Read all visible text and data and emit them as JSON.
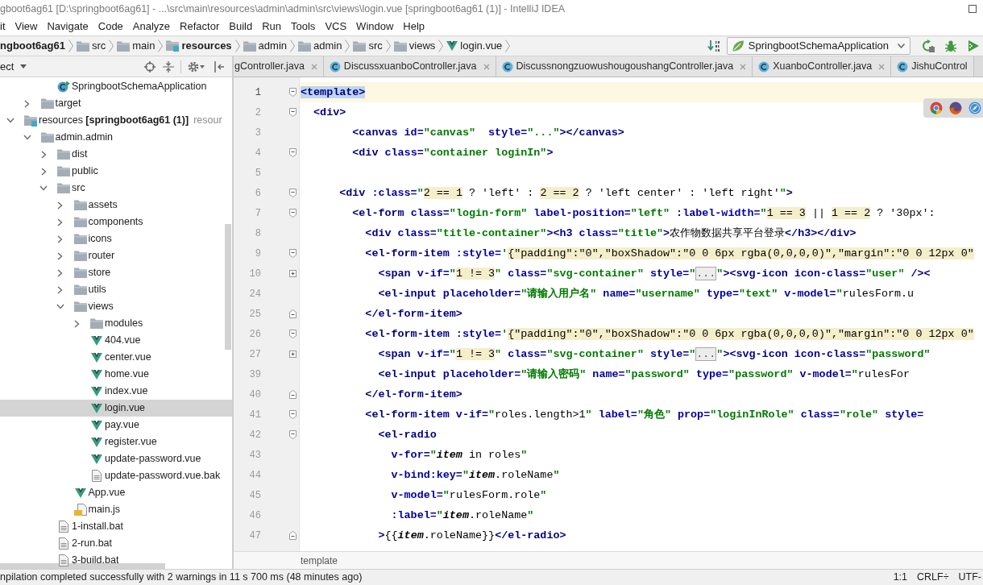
{
  "window": {
    "title": "gboot6ag61 [D:\\springboot6ag61] - ...\\src\\main\\resources\\admin\\admin\\src\\views\\login.vue [springboot6ag61 (1)] - IntelliJ IDEA"
  },
  "menu": [
    "it",
    "View",
    "Navigate",
    "Code",
    "Analyze",
    "Refactor",
    "Build",
    "Run",
    "Tools",
    "VCS",
    "Window",
    "Help"
  ],
  "navigation": {
    "crumbs": [
      {
        "label": "ngboot6ag61",
        "kind": "project"
      },
      {
        "label": "src",
        "kind": "folder"
      },
      {
        "label": "main",
        "kind": "folder"
      },
      {
        "label": "resources",
        "kind": "resources"
      },
      {
        "label": "admin",
        "kind": "folder"
      },
      {
        "label": "admin",
        "kind": "folder"
      },
      {
        "label": "src",
        "kind": "folder"
      },
      {
        "label": "views",
        "kind": "folder"
      },
      {
        "label": "login.vue",
        "kind": "vue"
      }
    ],
    "run_config": "SpringbootSchemaApplication"
  },
  "project_panel": {
    "title": "ect",
    "tree": [
      {
        "children": [
          {
            "children": [
              {
                "label": "SpringbootSchemaApplication",
                "kind": "class",
                "selected": false
              }
            ]
          },
          {
            "label": "target",
            "kind": "folder",
            "expanded": false,
            "selected": false
          }
        ]
      },
      {
        "label": "resources **[springboot6ag61 (1)]**",
        "hint": "resour",
        "kind": "resources",
        "expanded": true,
        "selected": false,
        "children": [
          {
            "label": "admin.admin",
            "kind": "folder",
            "expanded": true,
            "selected": false,
            "children": [
              {
                "label": "dist",
                "kind": "folder",
                "expanded": false,
                "selected": false
              },
              {
                "label": "public",
                "kind": "folder",
                "expanded": false,
                "selected": false
              },
              {
                "label": "src",
                "kind": "folder",
                "expanded": true,
                "selected": false,
                "children": [
                  {
                    "label": "assets",
                    "kind": "folder",
                    "expanded": false,
                    "selected": false
                  },
                  {
                    "label": "components",
                    "kind": "folder",
                    "expanded": false,
                    "selected": false
                  },
                  {
                    "label": "icons",
                    "kind": "folder",
                    "expanded": false,
                    "selected": false
                  },
                  {
                    "label": "router",
                    "kind": "folder",
                    "expanded": false,
                    "selected": false
                  },
                  {
                    "label": "store",
                    "kind": "folder",
                    "expanded": false,
                    "selected": false
                  },
                  {
                    "label": "utils",
                    "kind": "folder",
                    "expanded": false,
                    "selected": false
                  },
                  {
                    "label": "views",
                    "kind": "folder",
                    "expanded": true,
                    "selected": false,
                    "children": [
                      {
                        "label": "modules",
                        "kind": "folder",
                        "expanded": false,
                        "selected": false
                      },
                      {
                        "label": "404.vue",
                        "kind": "vue",
                        "selected": false
                      },
                      {
                        "label": "center.vue",
                        "kind": "vue",
                        "selected": false
                      },
                      {
                        "label": "home.vue",
                        "kind": "vue",
                        "selected": false
                      },
                      {
                        "label": "index.vue",
                        "kind": "vue",
                        "selected": false
                      },
                      {
                        "label": "login.vue",
                        "kind": "vue",
                        "selected": true
                      },
                      {
                        "label": "pay.vue",
                        "kind": "vue",
                        "selected": false
                      },
                      {
                        "label": "register.vue",
                        "kind": "vue",
                        "selected": false
                      },
                      {
                        "label": "update-password.vue",
                        "kind": "vue",
                        "selected": false
                      },
                      {
                        "label": "update-password.vue.bak",
                        "kind": "file",
                        "selected": false
                      }
                    ]
                  },
                  {
                    "label": "App.vue",
                    "kind": "vue",
                    "selected": false
                  },
                  {
                    "label": "main.js",
                    "kind": "script",
                    "selected": false
                  }
                ]
              },
              {
                "label": "1-install.bat",
                "kind": "file",
                "selected": false
              },
              {
                "label": "2-run.bat",
                "kind": "file",
                "selected": false
              },
              {
                "label": "3-build.bat",
                "kind": "file",
                "selected": false
              }
            ]
          }
        ]
      }
    ]
  },
  "tabs": [
    {
      "label": "gController.java",
      "icon": false,
      "close": true
    },
    {
      "label": "DiscussxuanboController.java",
      "icon": true,
      "close": true
    },
    {
      "label": "DiscussnongzuowushougoushangController.java",
      "icon": true,
      "close": true
    },
    {
      "label": "XuanboController.java",
      "icon": true,
      "close": true
    },
    {
      "label": "JishuControl",
      "icon": true,
      "close": false
    }
  ],
  "editor": {
    "lines": [
      {
        "number": "1",
        "current": true,
        "kind": "opener",
        "segments": [
          {
            "kind": "match",
            "text": "<template>"
          }
        ]
      },
      {
        "number": "2",
        "current": false,
        "kind": "opener",
        "segments": [
          {
            "kind": "tag",
            "text": "  <div>"
          }
        ]
      },
      {
        "number": "3",
        "current": false,
        "kind": "plain",
        "segments": [
          {
            "kind": "tag",
            "text": "        <canvas"
          },
          {
            "kind": "attr",
            "text": " id="
          },
          {
            "kind": "value",
            "text": "\"canvas\""
          },
          {
            "kind": "attr",
            "text": "  style="
          },
          {
            "kind": "value",
            "text": "\"...\""
          },
          {
            "kind": "tag",
            "text": "></canvas>"
          }
        ]
      },
      {
        "number": "4",
        "current": false,
        "kind": "opener",
        "segments": [
          {
            "kind": "tag",
            "text": "        <div"
          },
          {
            "kind": "attr",
            "text": " class="
          },
          {
            "kind": "value",
            "text": "\"container loginIn\""
          },
          {
            "kind": "tag",
            "text": ">"
          }
        ]
      },
      {
        "number": "5",
        "current": false,
        "kind": "plain"
      },
      {
        "number": "6",
        "current": false,
        "kind": "opener",
        "segments": [
          {
            "kind": "tag",
            "text": "      <div"
          },
          {
            "kind": "attr",
            "text": " :class="
          },
          {
            "kind": "value",
            "text": "\""
          },
          {
            "kind": "expr",
            "text": "2 == 1"
          },
          {
            "kind": "plain",
            "text": " ? 'left' : "
          },
          {
            "kind": "expr",
            "text": "2 == 2"
          },
          {
            "kind": "plain",
            "text": " ? 'left center' : 'left right'"
          },
          {
            "kind": "value",
            "text": "\""
          },
          {
            "kind": "tag",
            "text": ">"
          }
        ]
      },
      {
        "number": "7",
        "current": false,
        "kind": "opener",
        "segments": [
          {
            "kind": "tag",
            "text": "        <el-form"
          },
          {
            "kind": "attr",
            "text": " class="
          },
          {
            "kind": "value",
            "text": "\"login-form\""
          },
          {
            "kind": "attr",
            "text": " label-position="
          },
          {
            "kind": "value",
            "text": "\"left\""
          },
          {
            "kind": "attr",
            "text": " :label-width="
          },
          {
            "kind": "value",
            "text": "\""
          },
          {
            "kind": "expr",
            "text": "1 == 3"
          },
          {
            "kind": "plain",
            "text": " || "
          },
          {
            "kind": "expr",
            "text": "1 == 2"
          },
          {
            "kind": "plain",
            "text": " ? '30px':"
          }
        ]
      },
      {
        "number": "8",
        "current": false,
        "kind": "plain",
        "segments": [
          {
            "kind": "tag",
            "text": "          <div"
          },
          {
            "kind": "attr",
            "text": " class="
          },
          {
            "kind": "value",
            "text": "\"title-container\""
          },
          {
            "kind": "tag",
            "text": "><h3"
          },
          {
            "kind": "attr",
            "text": " class="
          },
          {
            "kind": "value",
            "text": "\"title\""
          },
          {
            "kind": "tag",
            "text": ">"
          },
          {
            "kind": "plain",
            "text": "农作物数据共享平台登录"
          },
          {
            "kind": "tag",
            "text": "</h3></div>"
          }
        ]
      },
      {
        "number": "9",
        "current": false,
        "kind": "opener",
        "segments": [
          {
            "kind": "tag",
            "text": "          <el-form-item"
          },
          {
            "kind": "attr",
            "text": " :style="
          },
          {
            "kind": "value",
            "text": "'"
          },
          {
            "kind": "expr",
            "text": "{\"padding\":\"0\",\"boxShadow\":\"0 0 6px rgba(0,0,0,0)\",\"margin\":\"0 0 12px 0\""
          }
        ]
      },
      {
        "number": "10",
        "current": false,
        "kind": "folded",
        "segments": [
          {
            "kind": "tag",
            "text": "            <span"
          },
          {
            "kind": "attr",
            "text": " v-if="
          },
          {
            "kind": "value",
            "text": "\""
          },
          {
            "kind": "expr",
            "text": "1 != 3"
          },
          {
            "kind": "value",
            "text": "\""
          },
          {
            "kind": "attr",
            "text": " class="
          },
          {
            "kind": "value",
            "text": "\"svg-container\""
          },
          {
            "kind": "attr",
            "text": " style="
          },
          {
            "kind": "value",
            "text": "\""
          },
          {
            "kind": "folded",
            "text": "..."
          },
          {
            "kind": "value",
            "text": "\""
          },
          {
            "kind": "tag",
            "text": "><svg-icon"
          },
          {
            "kind": "attr",
            "text": " icon-class="
          },
          {
            "kind": "value",
            "text": "\"user\""
          },
          {
            "kind": "tag",
            "text": " /><"
          }
        ]
      },
      {
        "number": "24",
        "current": false,
        "kind": "plain",
        "segments": [
          {
            "kind": "tag",
            "text": "            <el-input"
          },
          {
            "kind": "attr",
            "text": " placeholder="
          },
          {
            "kind": "value",
            "text": "\"请输入用户名\""
          },
          {
            "kind": "attr",
            "text": " name="
          },
          {
            "kind": "value",
            "text": "\"username\""
          },
          {
            "kind": "attr",
            "text": " type="
          },
          {
            "kind": "value",
            "text": "\"text\""
          },
          {
            "kind": "attr",
            "text": " v-model="
          },
          {
            "kind": "value",
            "text": "\""
          },
          {
            "kind": "plain",
            "text": "rulesForm.u"
          }
        ]
      },
      {
        "number": "25",
        "current": false,
        "kind": "closer",
        "segments": [
          {
            "kind": "tag",
            "text": "          </el-form-item>"
          }
        ]
      },
      {
        "number": "26",
        "current": false,
        "kind": "opener",
        "segments": [
          {
            "kind": "tag",
            "text": "          <el-form-item"
          },
          {
            "kind": "attr",
            "text": " :style="
          },
          {
            "kind": "value",
            "text": "'"
          },
          {
            "kind": "expr",
            "text": "{\"padding\":\"0\",\"boxShadow\":\"0 0 6px rgba(0,0,0,0)\",\"margin\":\"0 0 12px 0\""
          }
        ]
      },
      {
        "number": "27",
        "current": false,
        "kind": "folded",
        "segments": [
          {
            "kind": "tag",
            "text": "            <span"
          },
          {
            "kind": "attr",
            "text": " v-if="
          },
          {
            "kind": "value",
            "text": "\""
          },
          {
            "kind": "expr",
            "text": "1 != 3"
          },
          {
            "kind": "value",
            "text": "\""
          },
          {
            "kind": "attr",
            "text": " class="
          },
          {
            "kind": "value",
            "text": "\"svg-container\""
          },
          {
            "kind": "attr",
            "text": " style="
          },
          {
            "kind": "value",
            "text": "\""
          },
          {
            "kind": "folded",
            "text": "..."
          },
          {
            "kind": "value",
            "text": "\""
          },
          {
            "kind": "tag",
            "text": "><svg-icon"
          },
          {
            "kind": "attr",
            "text": " icon-class="
          },
          {
            "kind": "value",
            "text": "\"password\""
          }
        ]
      },
      {
        "number": "39",
        "current": false,
        "kind": "plain",
        "segments": [
          {
            "kind": "tag",
            "text": "            <el-input"
          },
          {
            "kind": "attr",
            "text": " placeholder="
          },
          {
            "kind": "value",
            "text": "\"请输入密码\""
          },
          {
            "kind": "attr",
            "text": " name="
          },
          {
            "kind": "value",
            "text": "\"password\""
          },
          {
            "kind": "attr",
            "text": " type="
          },
          {
            "kind": "value",
            "text": "\"password\""
          },
          {
            "kind": "attr",
            "text": " v-model="
          },
          {
            "kind": "value",
            "text": "\""
          },
          {
            "kind": "plain",
            "text": "rulesFor"
          }
        ]
      },
      {
        "number": "40",
        "current": false,
        "kind": "closer",
        "segments": [
          {
            "kind": "tag",
            "text": "          </el-form-item>"
          }
        ]
      },
      {
        "number": "41",
        "current": false,
        "kind": "opener",
        "segments": [
          {
            "kind": "tag",
            "text": "          <el-form-item"
          },
          {
            "kind": "attr",
            "text": " v-if="
          },
          {
            "kind": "value",
            "text": "\""
          },
          {
            "kind": "plain",
            "text": "roles.length>1"
          },
          {
            "kind": "value",
            "text": "\""
          },
          {
            "kind": "attr",
            "text": " label="
          },
          {
            "kind": "value",
            "text": "\"角色\""
          },
          {
            "kind": "attr",
            "text": " prop="
          },
          {
            "kind": "value",
            "text": "\"loginInRole\""
          },
          {
            "kind": "attr",
            "text": " class="
          },
          {
            "kind": "value",
            "text": "\"role\""
          },
          {
            "kind": "attr",
            "text": " style="
          }
        ]
      },
      {
        "number": "42",
        "current": false,
        "kind": "opener",
        "segments": [
          {
            "kind": "tag",
            "text": "            <el-radio"
          }
        ]
      },
      {
        "number": "43",
        "current": false,
        "kind": "plain",
        "segments": [
          {
            "kind": "attr",
            "text": "              v-for="
          },
          {
            "kind": "value",
            "text": "\""
          },
          {
            "kind": "variable",
            "text": "item"
          },
          {
            "kind": "plain",
            "text": " in roles"
          },
          {
            "kind": "value",
            "text": "\""
          }
        ]
      },
      {
        "number": "44",
        "current": false,
        "kind": "plain",
        "segments": [
          {
            "kind": "attr",
            "text": "              v-bind:key="
          },
          {
            "kind": "value",
            "text": "\""
          },
          {
            "kind": "variable",
            "text": "item"
          },
          {
            "kind": "plain",
            "text": ".roleName"
          },
          {
            "kind": "value",
            "text": "\""
          }
        ]
      },
      {
        "number": "45",
        "current": false,
        "kind": "plain",
        "segments": [
          {
            "kind": "attr",
            "text": "              v-model="
          },
          {
            "kind": "value",
            "text": "\""
          },
          {
            "kind": "plain",
            "text": "rulesForm.role"
          },
          {
            "kind": "value",
            "text": "\""
          }
        ]
      },
      {
        "number": "46",
        "current": false,
        "kind": "plain",
        "segments": [
          {
            "kind": "attr",
            "text": "              :label="
          },
          {
            "kind": "value",
            "text": "\""
          },
          {
            "kind": "variable",
            "text": "item"
          },
          {
            "kind": "plain",
            "text": ".roleName"
          },
          {
            "kind": "value",
            "text": "\""
          }
        ]
      },
      {
        "number": "47",
        "current": false,
        "kind": "closer",
        "segments": [
          {
            "kind": "tag",
            "text": "            >"
          },
          {
            "kind": "plain",
            "text": "{{"
          },
          {
            "kind": "variable",
            "text": "item"
          },
          {
            "kind": "plain",
            "text": ".roleName}}"
          },
          {
            "kind": "tag",
            "text": "</el-radio>"
          }
        ]
      }
    ],
    "breadcrumb": "template"
  },
  "status_bar": {
    "message": "npilation completed successfully with 2 warnings in 11 s 700 ms (48 minutes ago)",
    "position": "1:1",
    "line_separator": "CRLF÷",
    "encoding": "UTF-"
  }
}
